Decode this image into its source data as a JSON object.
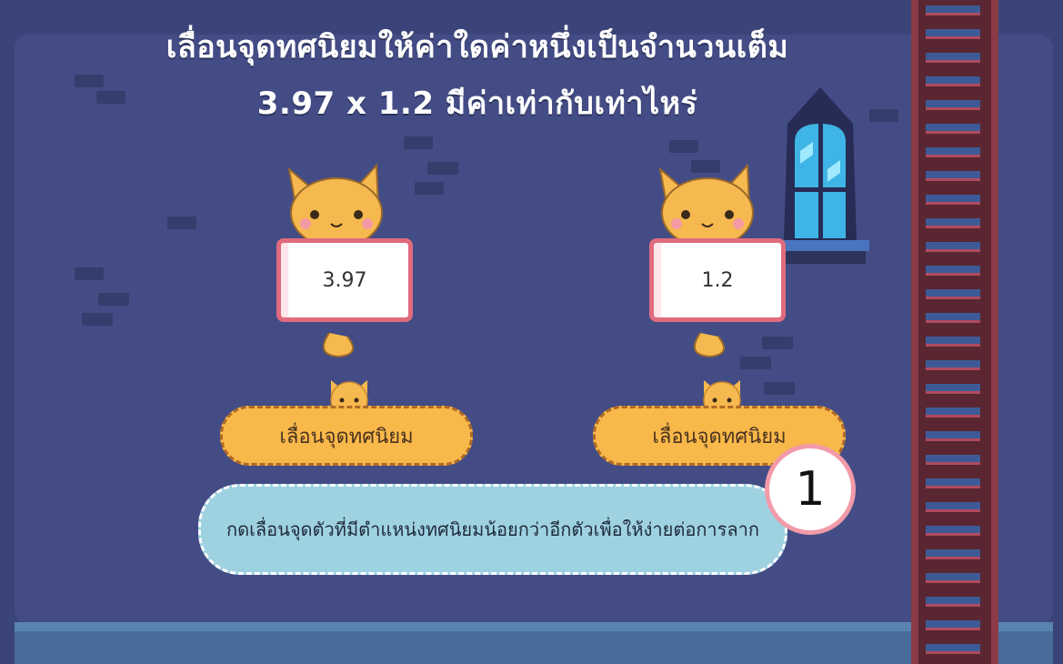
{
  "question": {
    "line1": "เลื่อนจุดทศนิยมให้ค่าใดค่าหนึ่งเป็นจำนวนเต็ม",
    "line2": "3.97 x 1.2 มีค่าเท่ากับเท่าไหร่"
  },
  "cards": [
    {
      "value": "3.97",
      "button_label": "เลื่อนจุดทศนิยม"
    },
    {
      "value": "1.2",
      "button_label": "เลื่อนจุดทศนิยม"
    }
  ],
  "hint": {
    "text": "กดเลื่อนจุดตัวที่มีตำแหน่งทศนิยมน้อยกว่าอีกตัวเพื่อให้ง่ายต่อการลาก",
    "step": "1"
  },
  "colors": {
    "background": "#3b4479",
    "panel": "#434c85",
    "button": "#f9b84a",
    "hint_bubble": "#9fd2e1",
    "card_border": "#e06b7e"
  },
  "icons": [
    "cat-character-icon",
    "cat-face-icon",
    "window-icon",
    "ladder-icon"
  ]
}
